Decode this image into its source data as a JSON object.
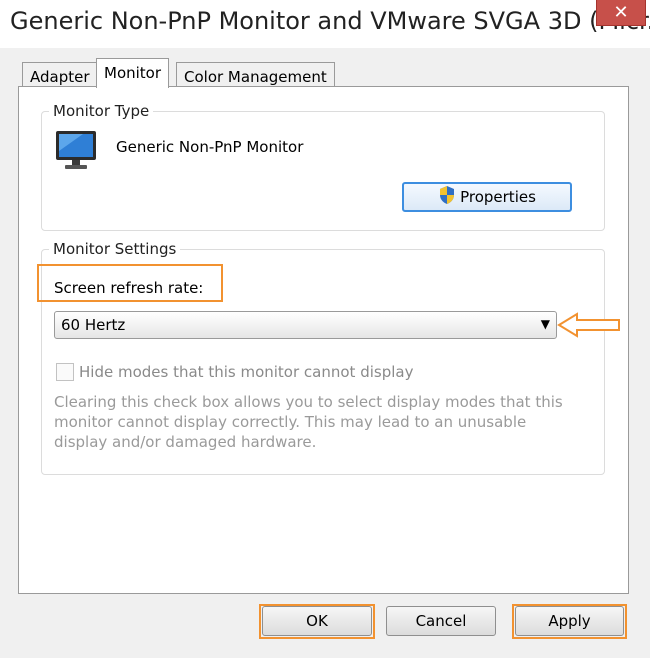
{
  "window": {
    "title": "Generic Non-PnP Monitor and VMware SVGA 3D (Micr...",
    "close_glyph": "✕"
  },
  "tabs": [
    {
      "label": "Adapter",
      "active": false
    },
    {
      "label": "Monitor",
      "active": true
    },
    {
      "label": "Color Management",
      "active": false
    }
  ],
  "monitor_type": {
    "group_label": "Monitor Type",
    "monitor_name": "Generic Non-PnP Monitor",
    "properties_label": "Properties",
    "icon": "monitor-icon"
  },
  "monitor_settings": {
    "group_label": "Monitor Settings",
    "refresh_label": "Screen refresh rate:",
    "refresh_value": "60 Hertz",
    "hide_modes_label": "Hide modes that this monitor cannot display",
    "hide_modes_checked": false,
    "description": "Clearing this check box allows you to select display modes that this monitor cannot display correctly. This may lead to an unusable display and/or damaged hardware."
  },
  "buttons": {
    "ok": "OK",
    "cancel": "Cancel",
    "apply": "Apply"
  },
  "colors": {
    "highlight": "#f29230",
    "close": "#c7504a",
    "accent": "#3d8ee0"
  }
}
